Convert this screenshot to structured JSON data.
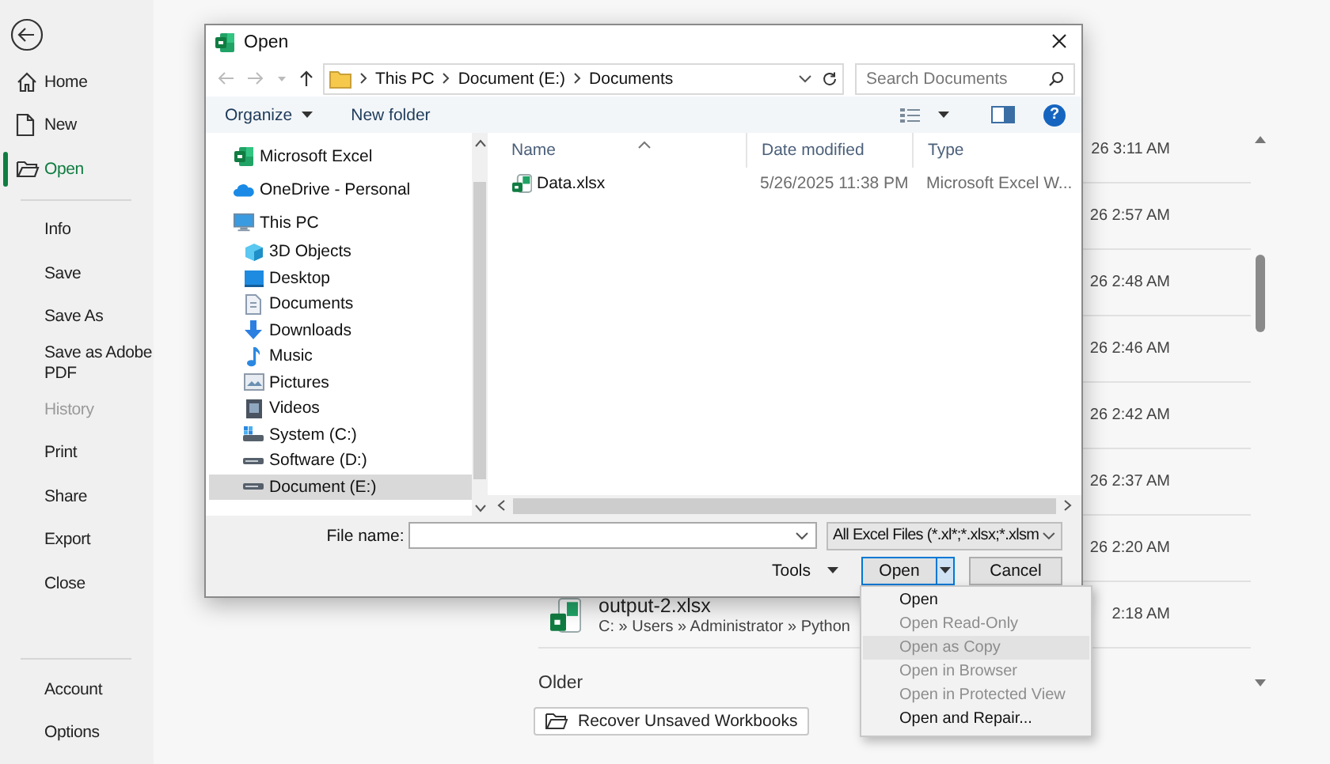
{
  "sidebar": {
    "primary": [
      {
        "label": "Home",
        "selected": false,
        "disabled": false
      },
      {
        "label": "New",
        "selected": false,
        "disabled": false
      },
      {
        "label": "Open",
        "selected": true,
        "disabled": false
      }
    ],
    "secondary": [
      {
        "label": "Info",
        "selected": false,
        "disabled": false
      },
      {
        "label": "Save",
        "selected": false,
        "disabled": false
      },
      {
        "label": "Save As",
        "selected": false,
        "disabled": false
      },
      {
        "label": "Save as Adobe PDF",
        "selected": false,
        "disabled": false
      },
      {
        "label": "History",
        "selected": false,
        "disabled": true
      },
      {
        "label": "Print",
        "selected": false,
        "disabled": false
      },
      {
        "label": "Share",
        "selected": false,
        "disabled": false
      },
      {
        "label": "Export",
        "selected": false,
        "disabled": false
      },
      {
        "label": "Close",
        "selected": false,
        "disabled": false
      }
    ],
    "footer": [
      {
        "label": "Account",
        "selected": false,
        "disabled": false
      },
      {
        "label": "Options",
        "selected": false,
        "disabled": false
      }
    ]
  },
  "recent": {
    "rows": [
      {
        "time": "26 3:11 AM"
      },
      {
        "time": "26 2:57 AM"
      },
      {
        "time": "26 2:48 AM"
      },
      {
        "time": "26 2:46 AM"
      },
      {
        "time": "26 2:42 AM"
      },
      {
        "time": "26 2:37 AM"
      },
      {
        "time": "26 2:20 AM"
      },
      {
        "name": "output-2.xlsx",
        "path": "C: » Users » Administrator » Python",
        "time": "2:18 AM"
      }
    ],
    "section": "Older",
    "recover_button": "Recover Unsaved Workbooks"
  },
  "dialog": {
    "title": "Open",
    "address": {
      "crumbs": [
        "This PC",
        "Document (E:)",
        "Documents"
      ]
    },
    "search": {
      "placeholder": "Search Documents"
    },
    "toolbar": {
      "organize": "Organize",
      "new_folder": "New folder",
      "help": "?"
    },
    "nav_pane": {
      "items": [
        {
          "label": "Microsoft Excel",
          "selected": false
        },
        {
          "label": "OneDrive - Personal",
          "selected": false
        },
        {
          "label": "This PC",
          "selected": false,
          "children": [
            {
              "label": "3D Objects",
              "selected": false
            },
            {
              "label": "Desktop",
              "selected": false
            },
            {
              "label": "Documents",
              "selected": false
            },
            {
              "label": "Downloads",
              "selected": false
            },
            {
              "label": "Music",
              "selected": false
            },
            {
              "label": "Pictures",
              "selected": false
            },
            {
              "label": "Videos",
              "selected": false
            },
            {
              "label": "System (C:)",
              "selected": false
            },
            {
              "label": "Software (D:)",
              "selected": false
            },
            {
              "label": "Document (E:)",
              "selected": true
            }
          ]
        }
      ]
    },
    "file_list": {
      "columns": [
        "Name",
        "Date modified",
        "Type"
      ],
      "rows": [
        {
          "name": "Data.xlsx",
          "date": "5/26/2025 11:38 PM",
          "type": "Microsoft Excel W...",
          "selected": false
        }
      ]
    },
    "file_name": {
      "label": "File name:"
    },
    "file_type": "All Excel Files (*.xl*;*.xlsx;*.xlsm",
    "tools": "Tools",
    "open_button": "Open",
    "cancel_button": "Cancel"
  },
  "open_menu": {
    "items": [
      {
        "label": "Open",
        "disabled": false,
        "selected": false
      },
      {
        "label": "Open Read-Only",
        "disabled": true,
        "selected": false
      },
      {
        "label": "Open as Copy",
        "disabled": true,
        "selected": true
      },
      {
        "label": "Open in Browser",
        "disabled": true,
        "selected": false
      },
      {
        "label": "Open in Protected View",
        "disabled": true,
        "selected": false
      },
      {
        "label": "Open and Repair...",
        "disabled": false,
        "selected": false
      }
    ]
  }
}
